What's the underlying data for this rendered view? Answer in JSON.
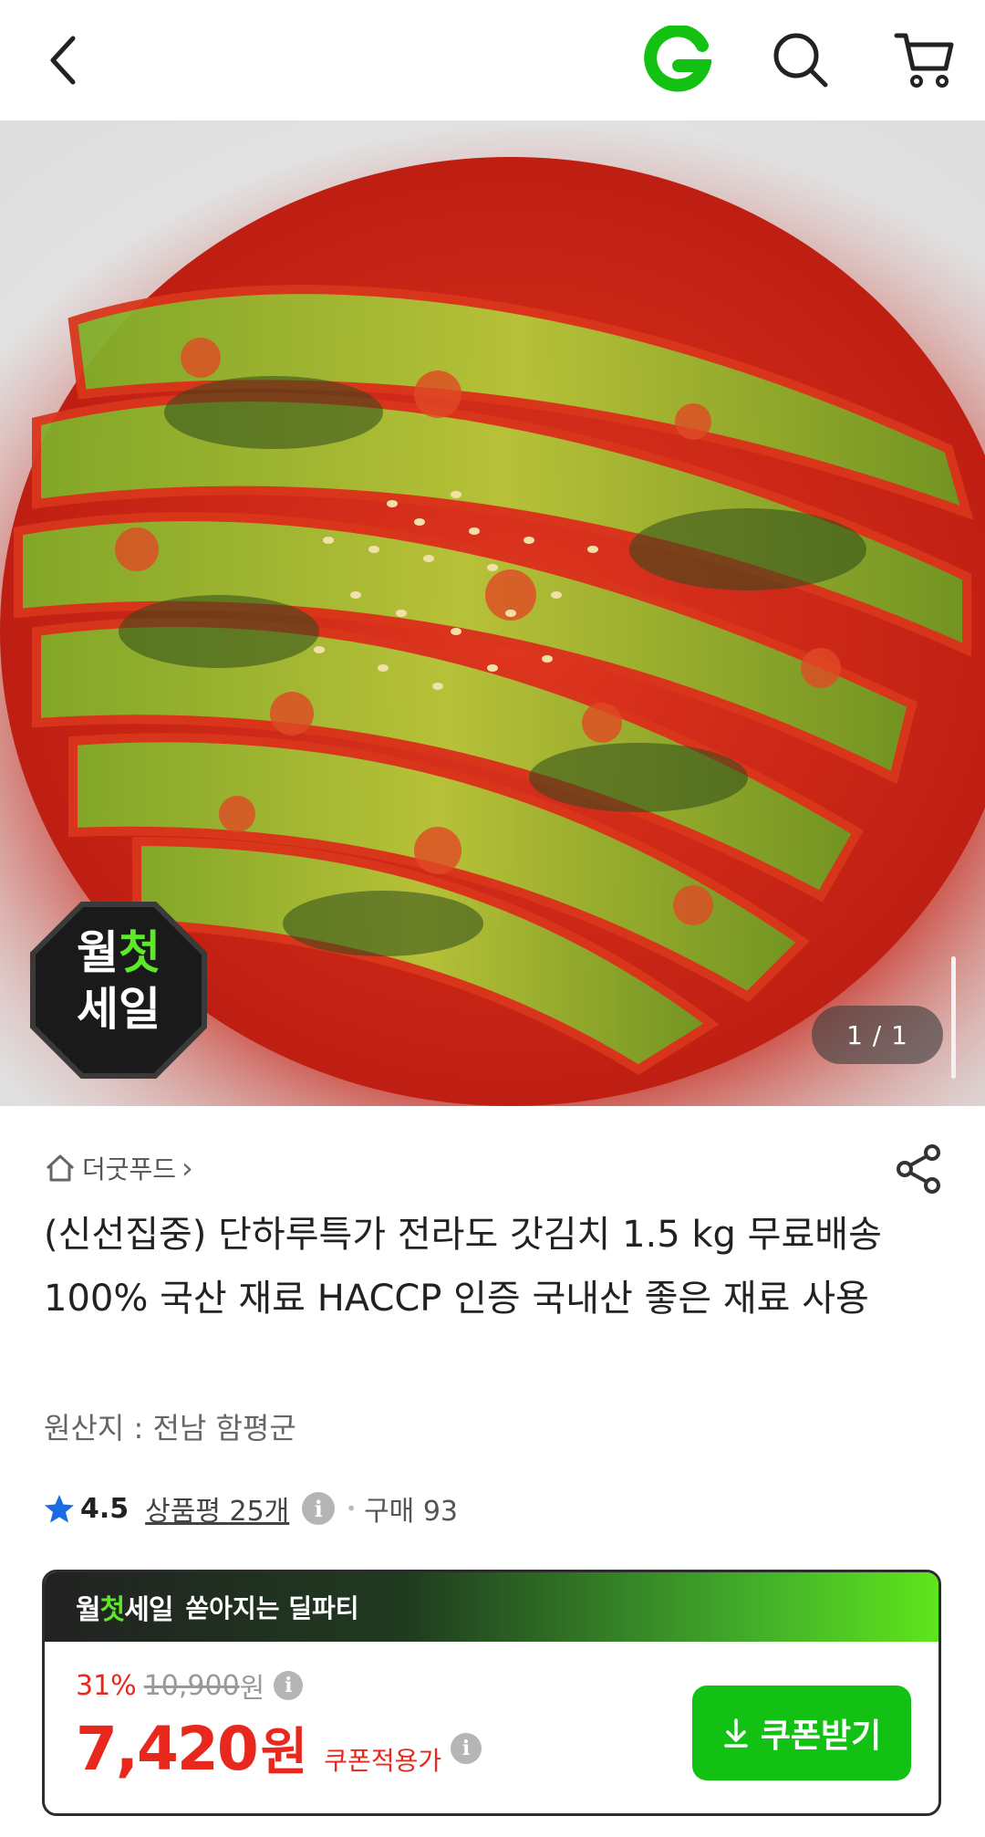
{
  "header": {
    "back_icon": "chevron-left-icon",
    "brand_icon": "gmarket-g-logo",
    "search_icon": "search-icon",
    "cart_icon": "cart-icon",
    "brand_color": "#12c112"
  },
  "gallery": {
    "badge_line1_a": "월",
    "badge_line1_b": "첫",
    "badge_line2": "세일",
    "counter": "1 / 1"
  },
  "store": {
    "name": "더굿푸드",
    "chevron": "›"
  },
  "product": {
    "title": "(신선집중) 단하루특가 전라도 갓김치 1.5 kg 무료배송 100% 국산 재료 HACCP 인증 국내산 좋은 재료 사용",
    "origin": "원산지 : 전남 함평군"
  },
  "rating": {
    "score": "4.5",
    "reviews": "상품평 25개",
    "purchase": "구매 93"
  },
  "deal": {
    "logo_a": "월",
    "logo_b": "첫",
    "logo_c": "세일",
    "tagline": "쏟아지는 딜파티",
    "discount_rate": "31%",
    "original_price": "10,900",
    "original_unit": "원",
    "price": "7,420",
    "price_unit": "원",
    "coupon_price_label": "쿠폰적용가",
    "coupon_button": "쿠폰받기",
    "accent_color": "#e8281c",
    "button_color": "#13c114"
  }
}
